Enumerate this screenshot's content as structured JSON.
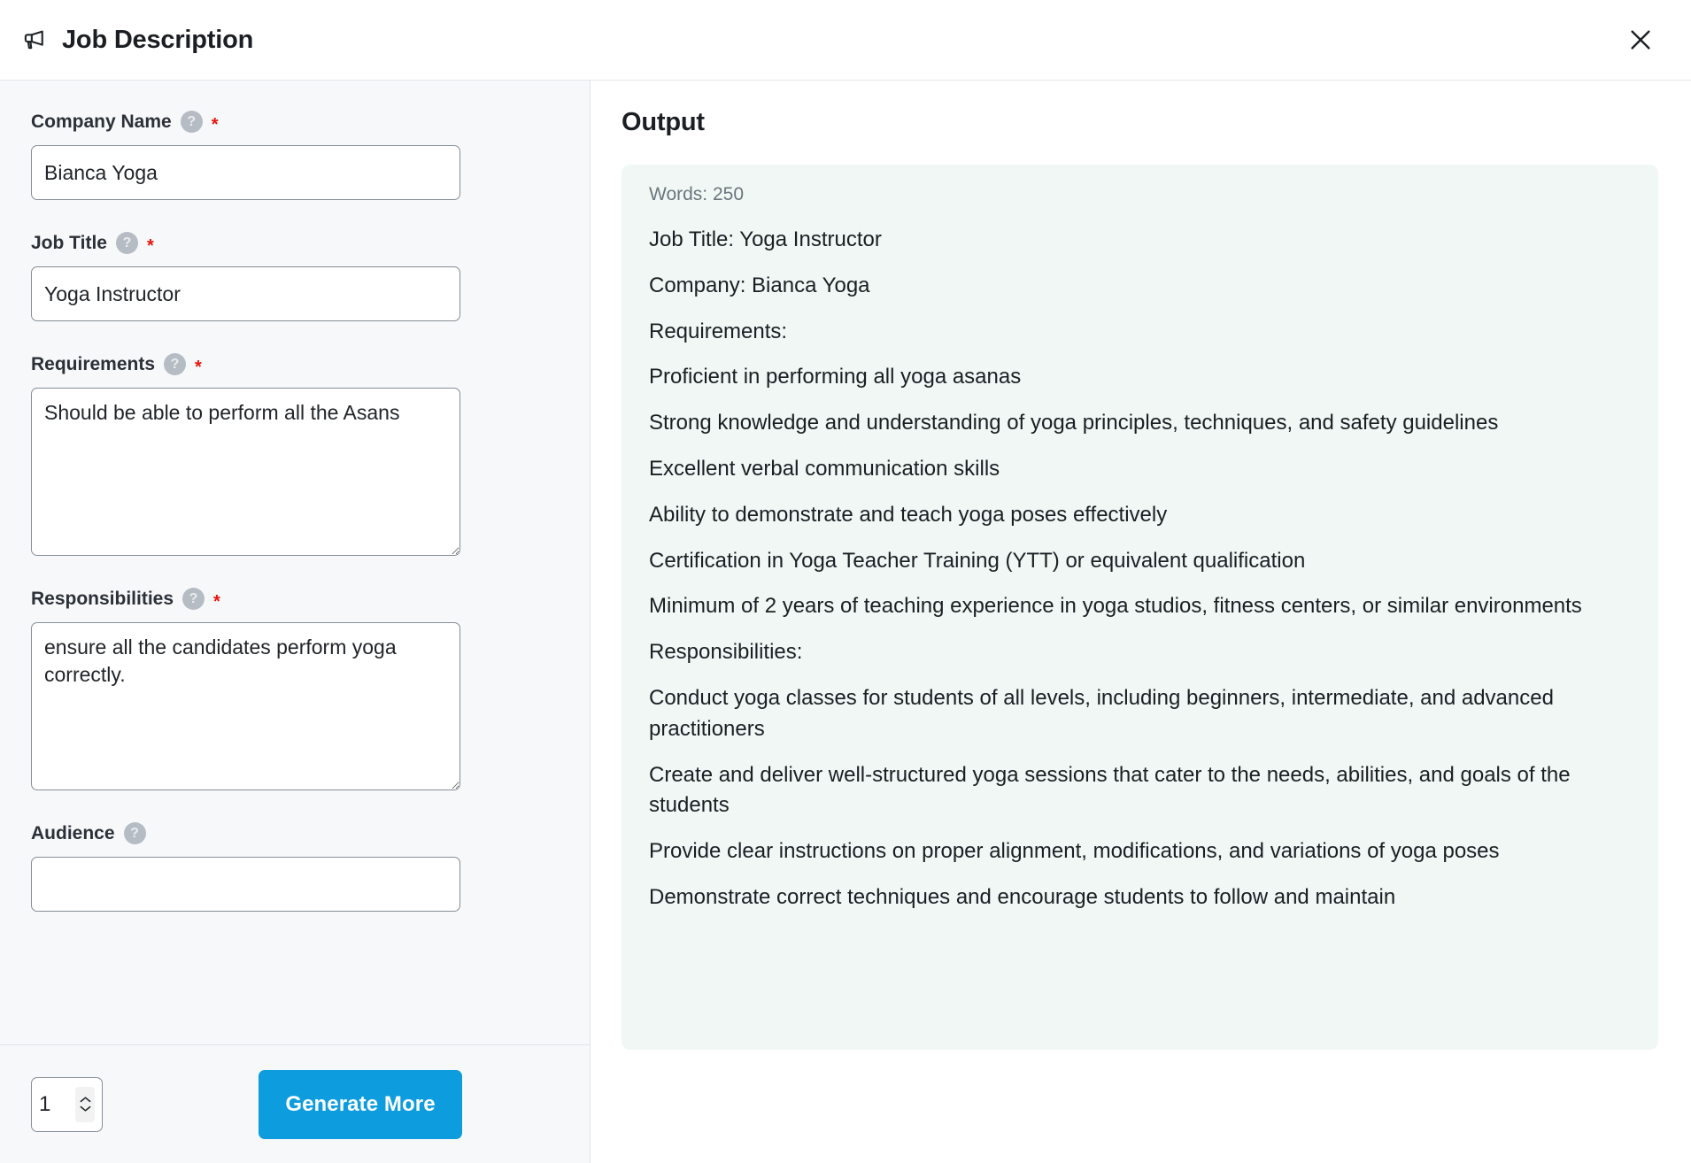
{
  "header": {
    "icon": "megaphone-icon",
    "title": "Job Description",
    "close_icon": "close-icon"
  },
  "form": {
    "fields": [
      {
        "label": "Company Name",
        "help_icon": "question-mark-icon",
        "required_marker": "*",
        "type": "input",
        "value": "Bianca Yoga",
        "placeholder": ""
      },
      {
        "label": "Job Title",
        "help_icon": "question-mark-icon",
        "required_marker": "*",
        "type": "input",
        "value": "Yoga Instructor",
        "placeholder": ""
      },
      {
        "label": "Requirements",
        "help_icon": "question-mark-icon",
        "required_marker": "*",
        "type": "textarea",
        "value": "Should be able to perform all the Asans",
        "placeholder": ""
      },
      {
        "label": "Responsibilities",
        "help_icon": "question-mark-icon",
        "required_marker": "*",
        "type": "textarea",
        "value": "ensure all the candidates perform yoga correctly.",
        "placeholder": ""
      },
      {
        "label": "Audience",
        "help_icon": "question-mark-icon",
        "required_marker": "",
        "type": "input",
        "value": "",
        "placeholder": ""
      }
    ]
  },
  "footer": {
    "count_value": "1",
    "generate_label": "Generate More"
  },
  "output": {
    "title": "Output",
    "words_label": "Words: 250",
    "lines": [
      "Job Title: Yoga Instructor",
      "Company: Bianca Yoga",
      "Requirements:",
      "Proficient in performing all yoga asanas",
      "Strong knowledge and understanding of yoga principles, techniques, and safety guidelines",
      "Excellent verbal communication skills",
      "Ability to demonstrate and teach yoga poses effectively",
      "Certification in Yoga Teacher Training (YTT) or equivalent qualification",
      "Minimum of 2 years of teaching experience in yoga studios, fitness centers, or similar environments",
      "Responsibilities:",
      "Conduct yoga classes for students of all levels, including beginners, intermediate, and advanced practitioners",
      "Create and deliver well-structured yoga sessions that cater to the needs, abilities, and goals of the students",
      "Provide clear instructions on proper alignment, modifications, and variations of yoga poses",
      "Demonstrate correct techniques and encourage students to follow and maintain"
    ]
  },
  "colors": {
    "accent_blue": "#0d9cdd",
    "required_red": "#e8140c",
    "panel_bg": "#f7f8fa",
    "output_card_bg": "#f0f7f4",
    "help_icon_gray": "#b6bcc4"
  }
}
